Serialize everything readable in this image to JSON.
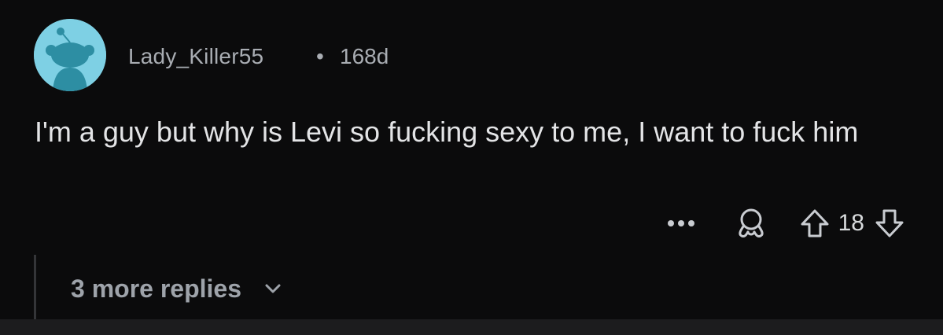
{
  "comment": {
    "username": "Lady_Killer55",
    "separator": "•",
    "age": "168d",
    "text": "I'm a guy but why is Levi so fucking sexy to me, I want to fuck him",
    "avatar_icon": "snoo-avatar-icon",
    "avatar_color": "#7ed0e4"
  },
  "actions": {
    "more_icon": "more-horizontal-icon",
    "award_icon": "award-icon",
    "upvote_icon": "arrow-up-icon",
    "vote_count": "18",
    "downvote_icon": "arrow-down-icon"
  },
  "replies": {
    "label": "3 more replies",
    "chevron_icon": "chevron-down-icon"
  },
  "colors": {
    "background": "#0b0b0c",
    "text_primary": "#e3e4e6",
    "text_meta": "#a9adb3"
  }
}
